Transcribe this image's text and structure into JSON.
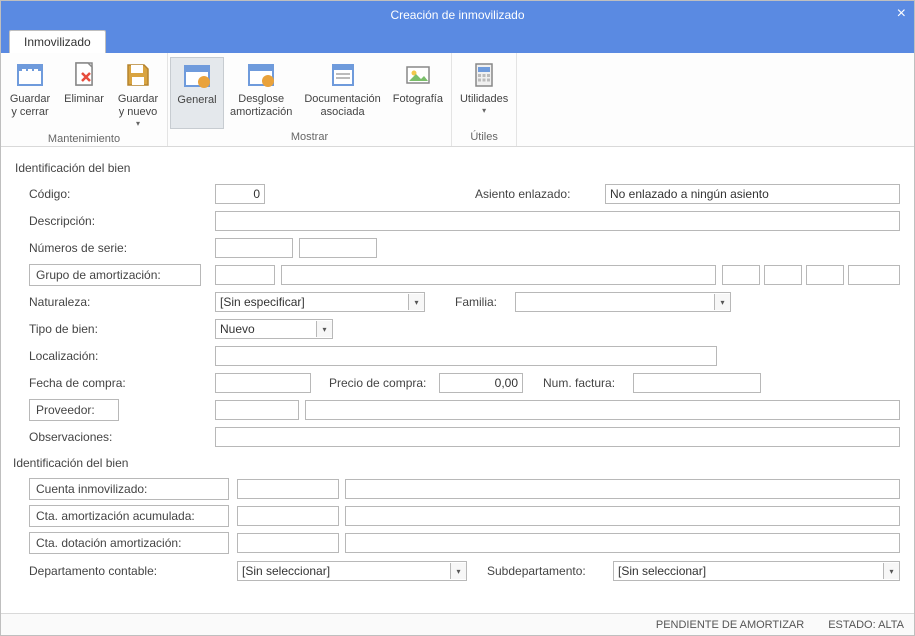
{
  "titlebar": {
    "title": "Creación de inmovilizado"
  },
  "tab": {
    "label": "Inmovilizado"
  },
  "ribbon": {
    "maintenance_label": "Mantenimiento",
    "show_label": "Mostrar",
    "utils_label": "Útiles",
    "save_close": "Guardar\ny cerrar",
    "delete": "Eliminar",
    "save_new": "Guardar\ny nuevo",
    "general": "General",
    "desglose": "Desglose\namortización",
    "docs": "Documentación\nasociada",
    "photo": "Fotografía",
    "utilities": "Utilidades"
  },
  "section1": "Identificación del bien",
  "section2": "Identificación del bien",
  "labels": {
    "codigo": "Código:",
    "asiento": "Asiento enlazado:",
    "descripcion": "Descripción:",
    "numeros_serie": "Números de serie:",
    "grupo_amort": "Grupo de amortización:",
    "naturaleza": "Naturaleza:",
    "familia": "Familia:",
    "tipo_bien": "Tipo de bien:",
    "localizacion": "Localización:",
    "fecha_compra": "Fecha de compra:",
    "precio_compra": "Precio de compra:",
    "num_factura": "Num. factura:",
    "proveedor": "Proveedor:",
    "observaciones": "Observaciones:",
    "cuenta_inmov": "Cuenta inmovilizado:",
    "cta_amort_acum": "Cta. amortización acumulada:",
    "cta_dot_amort": "Cta. dotación amortización:",
    "depto_contable": "Departamento contable:",
    "subdepto": "Subdepartamento:"
  },
  "values": {
    "codigo": "0",
    "asiento": "No enlazado a ningún asiento",
    "naturaleza": "[Sin especificar]",
    "tipo_bien": "Nuevo",
    "familia": "",
    "precio_compra": "0,00",
    "depto_contable": "[Sin seleccionar]",
    "subdepto": "[Sin seleccionar]"
  },
  "status": {
    "pend": "PENDIENTE DE AMORTIZAR",
    "estado": "ESTADO: ALTA"
  }
}
